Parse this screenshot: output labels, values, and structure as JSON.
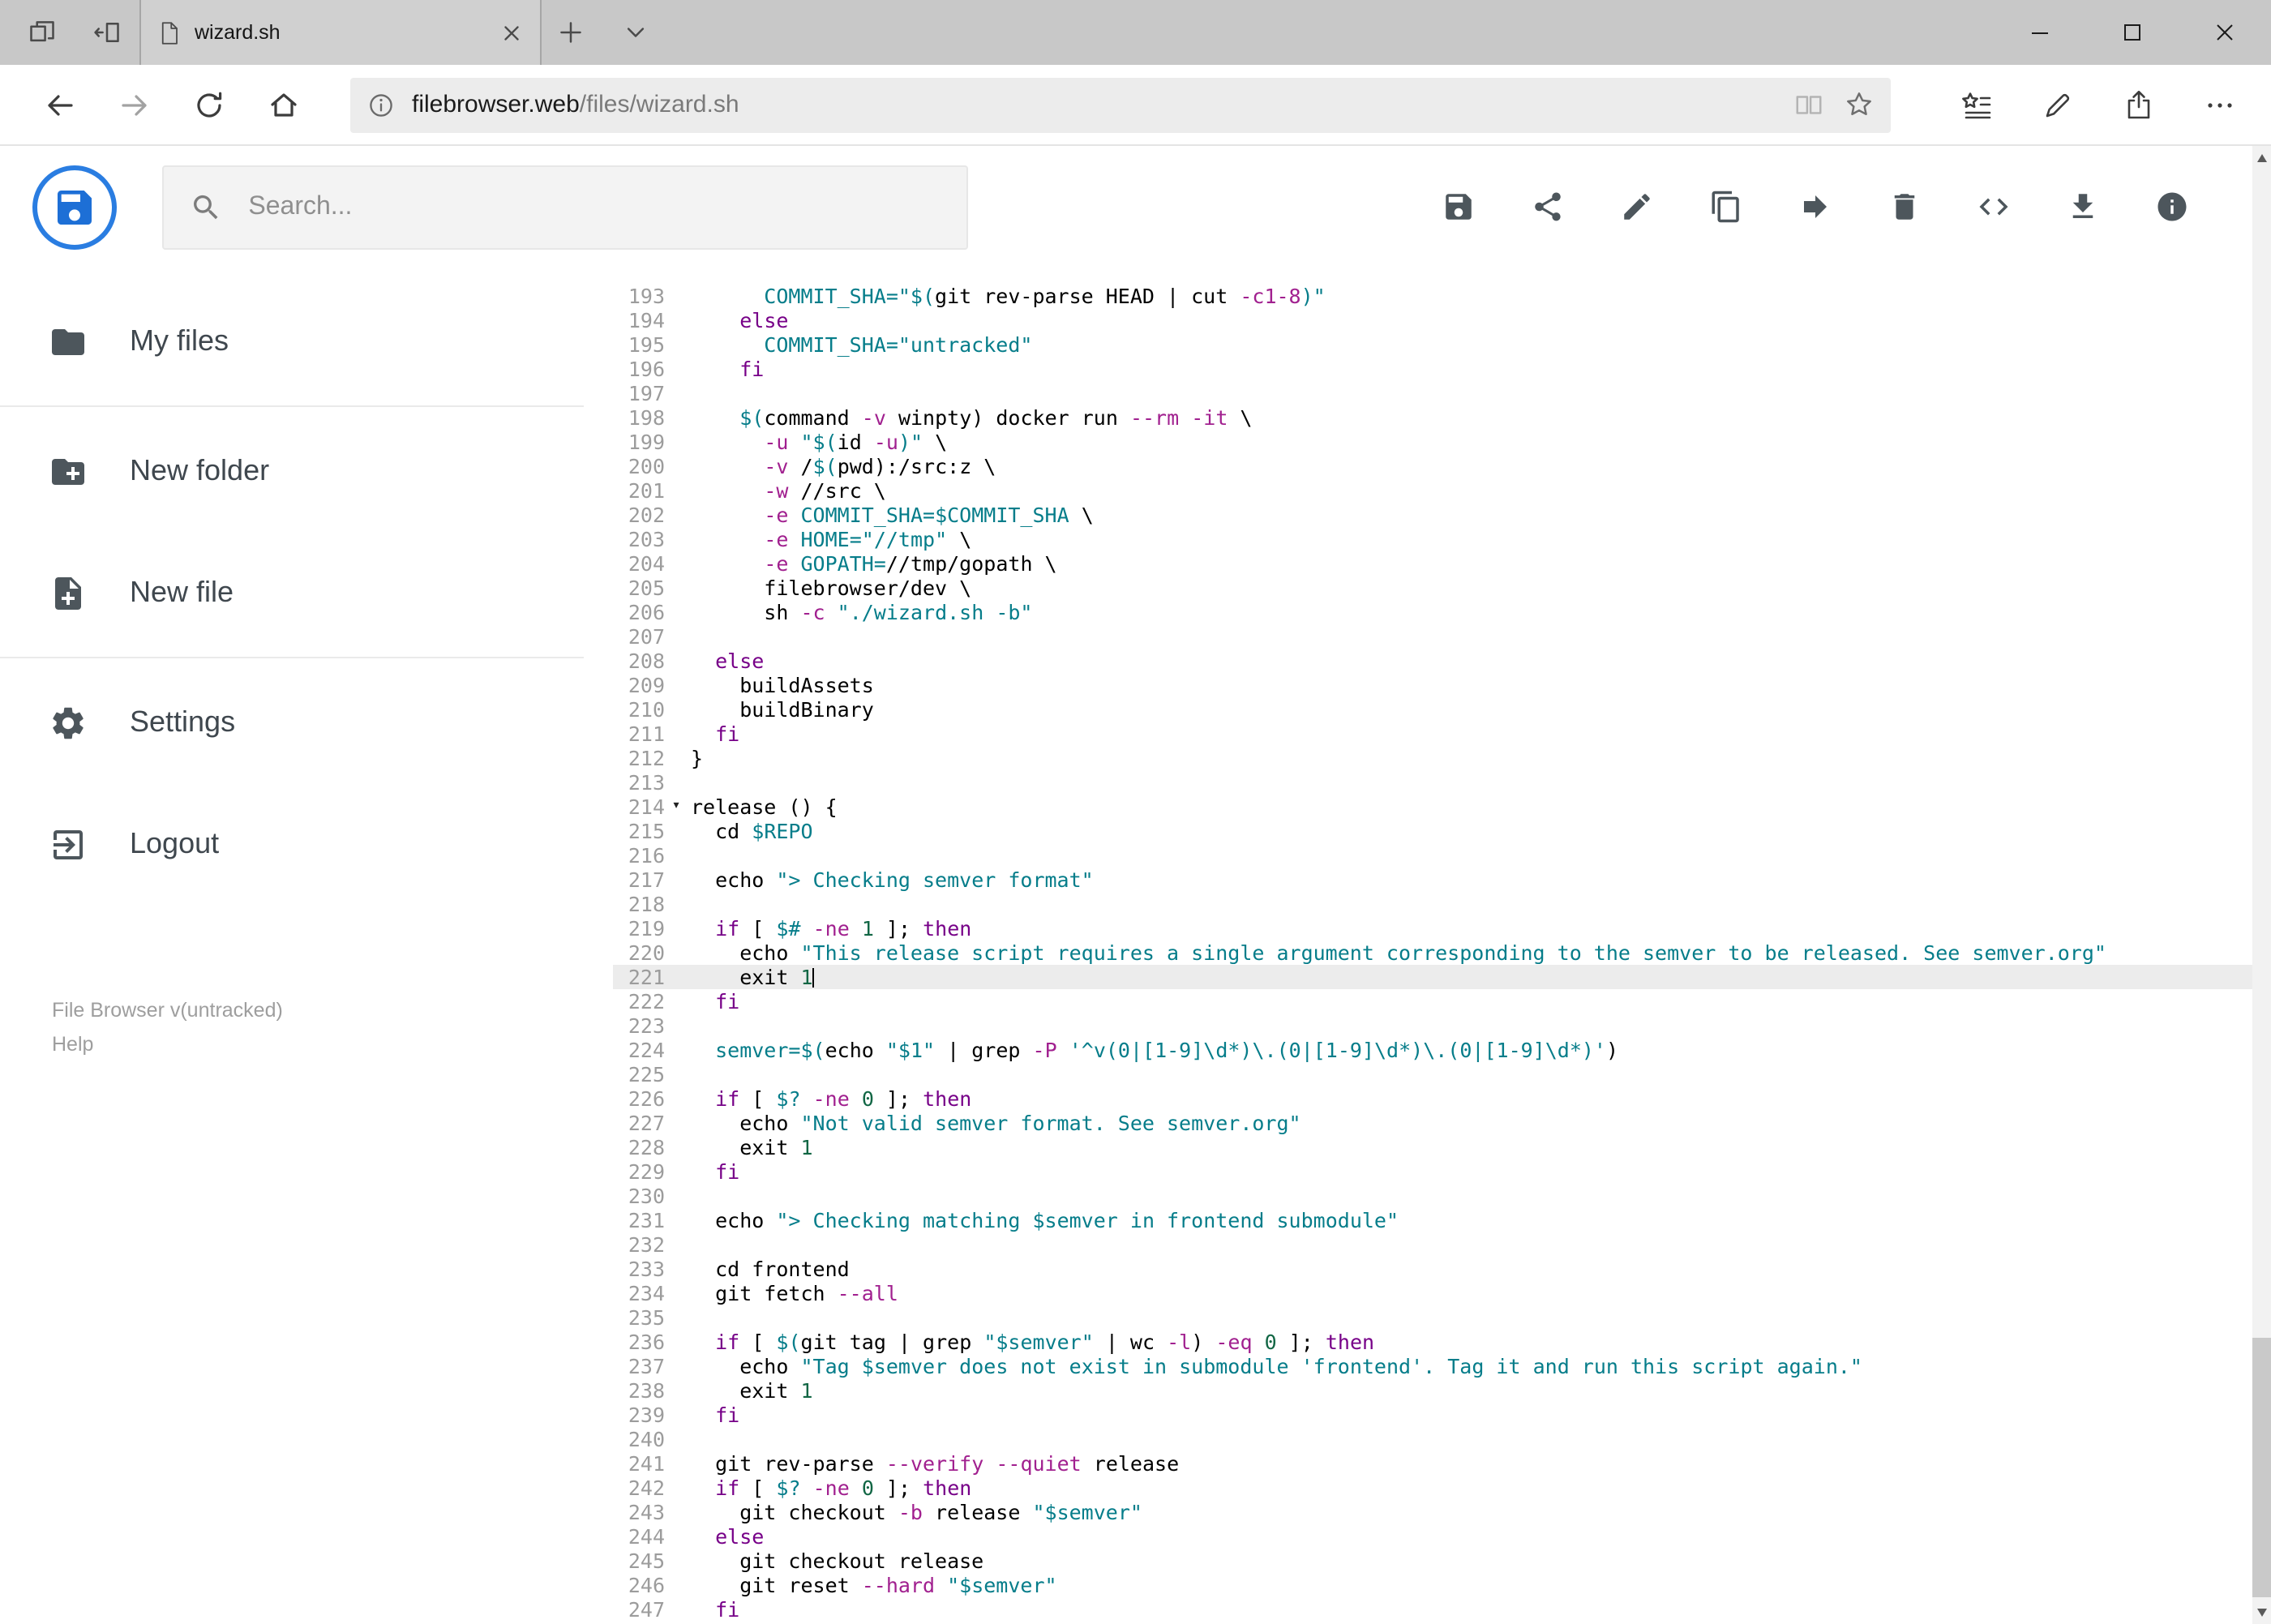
{
  "browser": {
    "tab_title": "wizard.sh",
    "url": {
      "host": "filebrowser.web",
      "path": "/files/wizard.sh"
    },
    "left_icons": [
      "tab-preview",
      "set-tabs-aside"
    ],
    "right_icons": [
      "hub",
      "web-note",
      "share",
      "more"
    ],
    "window_controls": [
      "minimize",
      "maximize",
      "close"
    ]
  },
  "header": {
    "search_placeholder": "Search...",
    "toolbar_icons": [
      "save",
      "share",
      "rename",
      "copy",
      "move",
      "delete",
      "raw-view",
      "download",
      "info"
    ]
  },
  "sidebar": {
    "items": [
      {
        "label": "My files",
        "icon": "folder"
      },
      {
        "label": "New folder",
        "icon": "create-new-folder"
      },
      {
        "label": "New file",
        "icon": "note-add"
      },
      {
        "label": "Settings",
        "icon": "settings"
      },
      {
        "label": "Logout",
        "icon": "logout"
      }
    ],
    "footer": {
      "version": "File Browser v(untracked)",
      "help": "Help"
    }
  },
  "colors": {
    "accent_blue": "#2a7de1",
    "keyword": "#770088",
    "string_teal": "#067d8a",
    "flag": "#a1208f"
  },
  "editor": {
    "active_line": 221,
    "fold_line": 214,
    "fold_marker": "▾",
    "lines": [
      {
        "n": 193,
        "t": [
          [
            "v",
            "      COMMIT_SHA="
          ],
          [
            "s",
            "\"$("
          ],
          [
            "p",
            "git rev-parse HEAD | cut "
          ],
          [
            "f",
            "-c1-8"
          ],
          [
            "s",
            ")\""
          ]
        ]
      },
      {
        "n": 194,
        "t": [
          [
            "p",
            "    "
          ],
          [
            "k",
            "else"
          ]
        ]
      },
      {
        "n": 195,
        "t": [
          [
            "v",
            "      COMMIT_SHA="
          ],
          [
            "s",
            "\"untracked\""
          ]
        ]
      },
      {
        "n": 196,
        "t": [
          [
            "p",
            "    "
          ],
          [
            "k",
            "fi"
          ]
        ]
      },
      {
        "n": 197,
        "t": []
      },
      {
        "n": 198,
        "t": [
          [
            "p",
            "    "
          ],
          [
            "v",
            "$("
          ],
          [
            "p",
            "command "
          ],
          [
            "f",
            "-v"
          ],
          [
            "p",
            " winpty) docker run "
          ],
          [
            "f",
            "--rm"
          ],
          [
            "p",
            " "
          ],
          [
            "f",
            "-it"
          ],
          [
            "p",
            " \\"
          ]
        ]
      },
      {
        "n": 199,
        "t": [
          [
            "p",
            "      "
          ],
          [
            "f",
            "-u"
          ],
          [
            "p",
            " "
          ],
          [
            "s",
            "\"$("
          ],
          [
            "p",
            "id "
          ],
          [
            "f",
            "-u"
          ],
          [
            "s",
            ")\""
          ],
          [
            "p",
            " \\"
          ]
        ]
      },
      {
        "n": 200,
        "t": [
          [
            "p",
            "      "
          ],
          [
            "f",
            "-v"
          ],
          [
            "p",
            " /"
          ],
          [
            "v",
            "$("
          ],
          [
            "p",
            "pwd):/src:z \\"
          ]
        ]
      },
      {
        "n": 201,
        "t": [
          [
            "p",
            "      "
          ],
          [
            "f",
            "-w"
          ],
          [
            "p",
            " //src \\"
          ]
        ]
      },
      {
        "n": 202,
        "t": [
          [
            "p",
            "      "
          ],
          [
            "f",
            "-e"
          ],
          [
            "p",
            " "
          ],
          [
            "v",
            "COMMIT_SHA=$COMMIT_SHA"
          ],
          [
            "p",
            " \\"
          ]
        ]
      },
      {
        "n": 203,
        "t": [
          [
            "p",
            "      "
          ],
          [
            "f",
            "-e"
          ],
          [
            "p",
            " "
          ],
          [
            "v",
            "HOME="
          ],
          [
            "s",
            "\"//tmp\""
          ],
          [
            "p",
            " \\"
          ]
        ]
      },
      {
        "n": 204,
        "t": [
          [
            "p",
            "      "
          ],
          [
            "f",
            "-e"
          ],
          [
            "p",
            " "
          ],
          [
            "v",
            "GOPATH="
          ],
          [
            "p",
            "//tmp/gopath \\"
          ]
        ]
      },
      {
        "n": 205,
        "t": [
          [
            "p",
            "      filebrowser/dev \\"
          ]
        ]
      },
      {
        "n": 206,
        "t": [
          [
            "p",
            "      sh "
          ],
          [
            "f",
            "-c"
          ],
          [
            "p",
            " "
          ],
          [
            "s",
            "\"./wizard.sh -b\""
          ]
        ]
      },
      {
        "n": 207,
        "t": []
      },
      {
        "n": 208,
        "t": [
          [
            "p",
            "  "
          ],
          [
            "k",
            "else"
          ]
        ]
      },
      {
        "n": 209,
        "t": [
          [
            "p",
            "    buildAssets"
          ]
        ]
      },
      {
        "n": 210,
        "t": [
          [
            "p",
            "    buildBinary"
          ]
        ]
      },
      {
        "n": 211,
        "t": [
          [
            "p",
            "  "
          ],
          [
            "k",
            "fi"
          ]
        ]
      },
      {
        "n": 212,
        "t": [
          [
            "p",
            "}"
          ]
        ]
      },
      {
        "n": 213,
        "t": []
      },
      {
        "n": 214,
        "t": [
          [
            "p",
            "release () {"
          ]
        ]
      },
      {
        "n": 215,
        "t": [
          [
            "p",
            "  cd "
          ],
          [
            "v",
            "$REPO"
          ]
        ]
      },
      {
        "n": 216,
        "t": []
      },
      {
        "n": 217,
        "t": [
          [
            "p",
            "  echo "
          ],
          [
            "s",
            "\"> Checking semver format\""
          ]
        ]
      },
      {
        "n": 218,
        "t": []
      },
      {
        "n": 219,
        "t": [
          [
            "p",
            "  "
          ],
          [
            "k",
            "if"
          ],
          [
            "p",
            " [ "
          ],
          [
            "v",
            "$#"
          ],
          [
            "p",
            " "
          ],
          [
            "f",
            "-ne"
          ],
          [
            "p",
            " "
          ],
          [
            "n",
            "1"
          ],
          [
            "p",
            " ]; "
          ],
          [
            "k",
            "then"
          ]
        ]
      },
      {
        "n": 220,
        "t": [
          [
            "p",
            "    echo "
          ],
          [
            "s",
            "\"This release script requires a single argument corresponding to the semver to be released. See semver.org\""
          ]
        ]
      },
      {
        "n": 221,
        "t": [
          [
            "p",
            "    exit "
          ],
          [
            "n",
            "1"
          ]
        ]
      },
      {
        "n": 222,
        "t": [
          [
            "p",
            "  "
          ],
          [
            "k",
            "fi"
          ]
        ]
      },
      {
        "n": 223,
        "t": []
      },
      {
        "n": 224,
        "t": [
          [
            "v",
            "  semver=$("
          ],
          [
            "p",
            "echo "
          ],
          [
            "s",
            "\"$1\""
          ],
          [
            "p",
            " | grep "
          ],
          [
            "f",
            "-P"
          ],
          [
            "p",
            " "
          ],
          [
            "s",
            "'^v(0|[1-9]\\d*)\\.(0|[1-9]\\d*)\\.(0|[1-9]\\d*)'"
          ],
          [
            "p",
            ")"
          ]
        ]
      },
      {
        "n": 225,
        "t": []
      },
      {
        "n": 226,
        "t": [
          [
            "p",
            "  "
          ],
          [
            "k",
            "if"
          ],
          [
            "p",
            " [ "
          ],
          [
            "v",
            "$?"
          ],
          [
            "p",
            " "
          ],
          [
            "f",
            "-ne"
          ],
          [
            "p",
            " "
          ],
          [
            "n",
            "0"
          ],
          [
            "p",
            " ]; "
          ],
          [
            "k",
            "then"
          ]
        ]
      },
      {
        "n": 227,
        "t": [
          [
            "p",
            "    echo "
          ],
          [
            "s",
            "\"Not valid semver format. See semver.org\""
          ]
        ]
      },
      {
        "n": 228,
        "t": [
          [
            "p",
            "    exit "
          ],
          [
            "n",
            "1"
          ]
        ]
      },
      {
        "n": 229,
        "t": [
          [
            "p",
            "  "
          ],
          [
            "k",
            "fi"
          ]
        ]
      },
      {
        "n": 230,
        "t": []
      },
      {
        "n": 231,
        "t": [
          [
            "p",
            "  echo "
          ],
          [
            "s",
            "\"> Checking matching "
          ],
          [
            "v",
            "$semver"
          ],
          [
            "s",
            " in frontend submodule\""
          ]
        ]
      },
      {
        "n": 232,
        "t": []
      },
      {
        "n": 233,
        "t": [
          [
            "p",
            "  cd frontend"
          ]
        ]
      },
      {
        "n": 234,
        "t": [
          [
            "p",
            "  git fetch "
          ],
          [
            "f",
            "--all"
          ]
        ]
      },
      {
        "n": 235,
        "t": []
      },
      {
        "n": 236,
        "t": [
          [
            "p",
            "  "
          ],
          [
            "k",
            "if"
          ],
          [
            "p",
            " [ "
          ],
          [
            "v",
            "$("
          ],
          [
            "p",
            "git tag | grep "
          ],
          [
            "s",
            "\"$semver\""
          ],
          [
            "p",
            " | wc "
          ],
          [
            "f",
            "-l"
          ],
          [
            "p",
            ") "
          ],
          [
            "f",
            "-eq"
          ],
          [
            "p",
            " "
          ],
          [
            "n",
            "0"
          ],
          [
            "p",
            " ]; "
          ],
          [
            "k",
            "then"
          ]
        ]
      },
      {
        "n": 237,
        "t": [
          [
            "p",
            "    echo "
          ],
          [
            "s",
            "\"Tag "
          ],
          [
            "v",
            "$semver"
          ],
          [
            "s",
            " does not exist in submodule 'frontend'. Tag it and run this script again.\""
          ]
        ]
      },
      {
        "n": 238,
        "t": [
          [
            "p",
            "    exit "
          ],
          [
            "n",
            "1"
          ]
        ]
      },
      {
        "n": 239,
        "t": [
          [
            "p",
            "  "
          ],
          [
            "k",
            "fi"
          ]
        ]
      },
      {
        "n": 240,
        "t": []
      },
      {
        "n": 241,
        "t": [
          [
            "p",
            "  git rev-parse "
          ],
          [
            "f",
            "--verify"
          ],
          [
            "p",
            " "
          ],
          [
            "f",
            "--quiet"
          ],
          [
            "p",
            " release"
          ]
        ]
      },
      {
        "n": 242,
        "t": [
          [
            "p",
            "  "
          ],
          [
            "k",
            "if"
          ],
          [
            "p",
            " [ "
          ],
          [
            "v",
            "$?"
          ],
          [
            "p",
            " "
          ],
          [
            "f",
            "-ne"
          ],
          [
            "p",
            " "
          ],
          [
            "n",
            "0"
          ],
          [
            "p",
            " ]; "
          ],
          [
            "k",
            "then"
          ]
        ]
      },
      {
        "n": 243,
        "t": [
          [
            "p",
            "    git checkout "
          ],
          [
            "f",
            "-b"
          ],
          [
            "p",
            " release "
          ],
          [
            "s",
            "\"$semver\""
          ]
        ]
      },
      {
        "n": 244,
        "t": [
          [
            "p",
            "  "
          ],
          [
            "k",
            "else"
          ]
        ]
      },
      {
        "n": 245,
        "t": [
          [
            "p",
            "    git checkout release"
          ]
        ]
      },
      {
        "n": 246,
        "t": [
          [
            "p",
            "    git reset "
          ],
          [
            "f",
            "--hard"
          ],
          [
            "p",
            " "
          ],
          [
            "s",
            "\"$semver\""
          ]
        ]
      },
      {
        "n": 247,
        "t": [
          [
            "p",
            "  "
          ],
          [
            "k",
            "fi"
          ]
        ]
      }
    ]
  }
}
